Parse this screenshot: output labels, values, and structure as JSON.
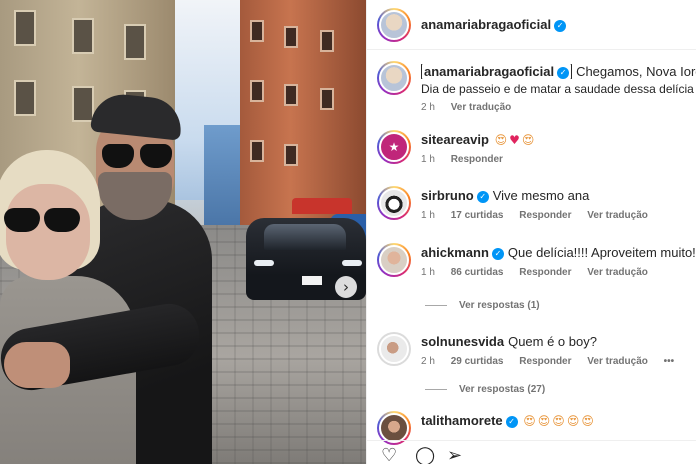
{
  "post": {
    "author": "anamariabragaoficial",
    "next_icon": "chevron-right-icon"
  },
  "caption": {
    "username": "anamariabragaoficial",
    "text": "Chegamos, Nova Iorque",
    "line2": "Dia de passeio e de matar a saudade dessa delícia de",
    "time": "2 h",
    "translate": "Ver tradução"
  },
  "comments": [
    {
      "username": "siteareavip",
      "verified": false,
      "text": "",
      "emojis": [
        "heart-eyes",
        "heart",
        "heart-eyes"
      ],
      "time": "1 h",
      "likes": "",
      "reply": "Responder",
      "translate": ""
    },
    {
      "username": "sirbruno",
      "verified": true,
      "text": "Vive mesmo ana",
      "time": "1 h",
      "likes": "17 curtidas",
      "reply": "Responder",
      "translate": "Ver tradução"
    },
    {
      "username": "ahickmann",
      "verified": true,
      "text": "Que delícia!!!! Aproveitem muito!!!!",
      "time": "1 h",
      "likes": "86 curtidas",
      "reply": "Responder",
      "translate": "Ver tradução",
      "replies": "Ver respostas (1)"
    },
    {
      "username": "solnunesvida",
      "verified": false,
      "text": "Quem é o boy?",
      "time": "2 h",
      "likes": "29 curtidas",
      "reply": "Responder",
      "translate": "Ver tradução",
      "more": "•••",
      "replies": "Ver respostas (27)"
    },
    {
      "username": "talithamorete",
      "verified": true,
      "text": "",
      "emojis": [
        "heart-eyes",
        "heart-eyes",
        "heart-eyes",
        "heart-eyes",
        "heart-eyes"
      ]
    }
  ],
  "glyphs": {
    "heart_eyes": "😍",
    "heart": "♥",
    "verified": "✓",
    "next": "›",
    "like": "♡",
    "comment": "◯",
    "share": "➢"
  },
  "colors": {
    "verified": "#0095f6",
    "text": "#262626",
    "muted": "#737373"
  }
}
